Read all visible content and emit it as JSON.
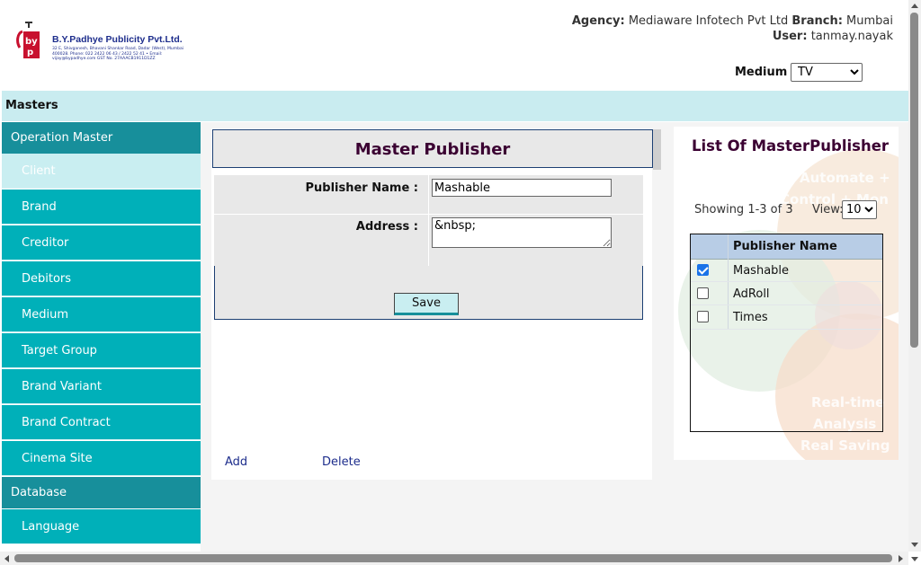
{
  "header": {
    "logo": {
      "name": "B.Y.Padhye Publicity Pvt.Ltd.",
      "address": "32 E, Shivganesh, Bhavani Shankar Road, Dadar (West), Mumbai 400028. Phone: 022 2422 06 43 / 2422 52 41 • Email: vijay@bypadhye.com GST No. 27AAACB1911D1ZZ",
      "brand_color": "#c8102e"
    },
    "agency_label": "Agency:",
    "agency_value": "Mediaware Infotech Pvt Ltd",
    "branch_label": "Branch:",
    "branch_value": "Mumbai",
    "user_label": "User:",
    "user_value": "tanmay.nayak",
    "medium_label": "Medium",
    "medium_selected": "TV"
  },
  "masters_bar": {
    "label": "Masters"
  },
  "sidebar": {
    "sections": [
      {
        "heading": "Operation Master",
        "items": [
          {
            "label": "Client",
            "active": true
          },
          {
            "label": "Brand"
          },
          {
            "label": "Creditor"
          },
          {
            "label": "Debitors"
          },
          {
            "label": "Medium"
          },
          {
            "label": "Target Group"
          },
          {
            "label": "Brand Variant"
          },
          {
            "label": "Brand Contract"
          },
          {
            "label": "Cinema Site"
          }
        ]
      },
      {
        "heading": "Database",
        "items": [
          {
            "label": "Language"
          }
        ]
      }
    ]
  },
  "form": {
    "title": "Master Publisher",
    "publisher_name_label": "Publisher Name :",
    "publisher_name_value": "Mashable",
    "address_label": "Address :",
    "address_value": "&nbsp;",
    "save_label": "Save",
    "add_link": "Add",
    "delete_link": "Delete"
  },
  "list": {
    "title": "List Of MasterPublisher",
    "showing": "Showing 1-3 of 3",
    "view_label": "View:",
    "view_selected": "10",
    "column_header": "Publisher Name",
    "rows": [
      {
        "name": "Mashable",
        "checked": true
      },
      {
        "name": "AdRoll",
        "checked": false
      },
      {
        "name": "Times",
        "checked": false
      }
    ],
    "watermark_lines": [
      "Automate +",
      "Control + Mon",
      "Real-time",
      "Analysis",
      "Real Saving"
    ]
  },
  "colors": {
    "accent_teal": "#00b0b9",
    "header_teal": "#178f9b",
    "light_teal": "#c9ecf0",
    "title_maroon": "#3b0032",
    "link_blue": "#1d2d8c"
  }
}
